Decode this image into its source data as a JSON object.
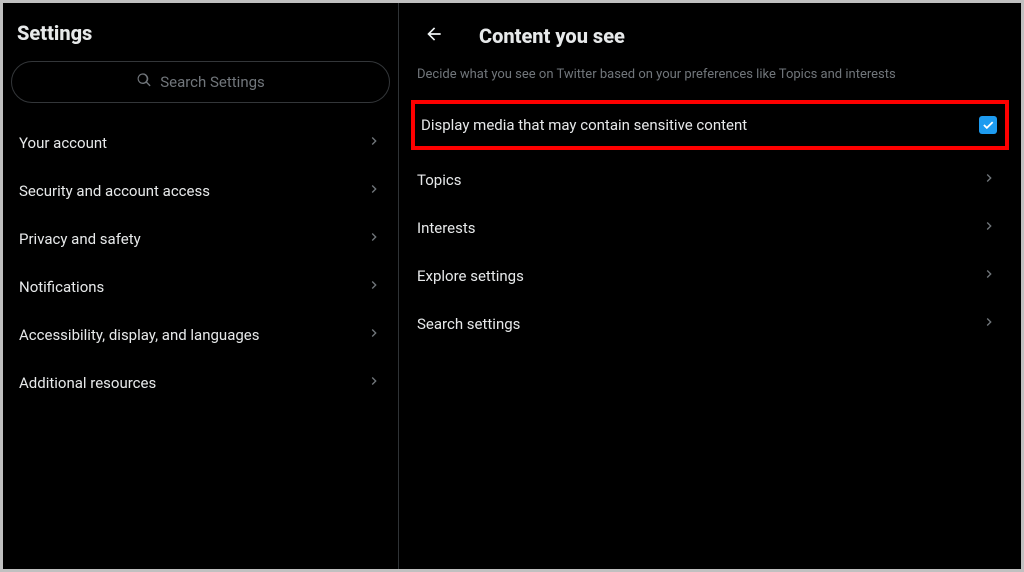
{
  "sidebar": {
    "title": "Settings",
    "search_placeholder": "Search Settings",
    "items": [
      {
        "label": "Your account"
      },
      {
        "label": "Security and account access"
      },
      {
        "label": "Privacy and safety"
      },
      {
        "label": "Notifications"
      },
      {
        "label": "Accessibility, display, and languages"
      },
      {
        "label": "Additional resources"
      }
    ]
  },
  "main": {
    "title": "Content you see",
    "subtitle": "Decide what you see on Twitter based on your preferences like Topics and interests",
    "sensitive_toggle": {
      "label": "Display media that may contain sensitive content",
      "checked": true
    },
    "items": [
      {
        "label": "Topics"
      },
      {
        "label": "Interests"
      },
      {
        "label": "Explore settings"
      },
      {
        "label": "Search settings"
      }
    ]
  }
}
